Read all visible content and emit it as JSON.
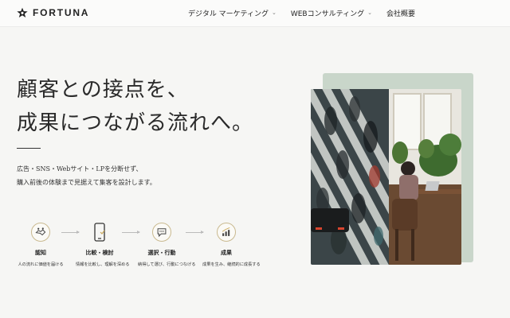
{
  "header": {
    "logo_text": "FORTUNA",
    "nav": [
      {
        "label": "デジタル マーケティング",
        "has_dropdown": true
      },
      {
        "label": "WEBコンサルティング",
        "has_dropdown": true
      },
      {
        "label": "会社概要",
        "has_dropdown": false
      }
    ]
  },
  "hero": {
    "headline_line1": "顧客との接点を、",
    "headline_line2": "成果につながる流れへ。",
    "lead_line1": "広告・SNS・Webサイト・LPを分断せず、",
    "lead_line2": "購入前後の体験まで見据えて集客を設計します。"
  },
  "steps": [
    {
      "icon": "handshake-icon",
      "title": "認知",
      "desc": "人の流れに価値を届ける"
    },
    {
      "icon": "smartphone-icon",
      "title": "比較・検討",
      "desc": "情報を比較し、理解を深める"
    },
    {
      "icon": "speech-bubble-icon",
      "title": "選択・行動",
      "desc": "納得して選び、行動につなげる"
    },
    {
      "icon": "growth-chart-icon",
      "title": "成果",
      "desc": "成果を生み、継続的に成長する"
    }
  ],
  "colors": {
    "background": "#f6f6f4",
    "accent_gold": "#c9b98f",
    "card_green": "#c9d6ca",
    "text": "#222222"
  }
}
